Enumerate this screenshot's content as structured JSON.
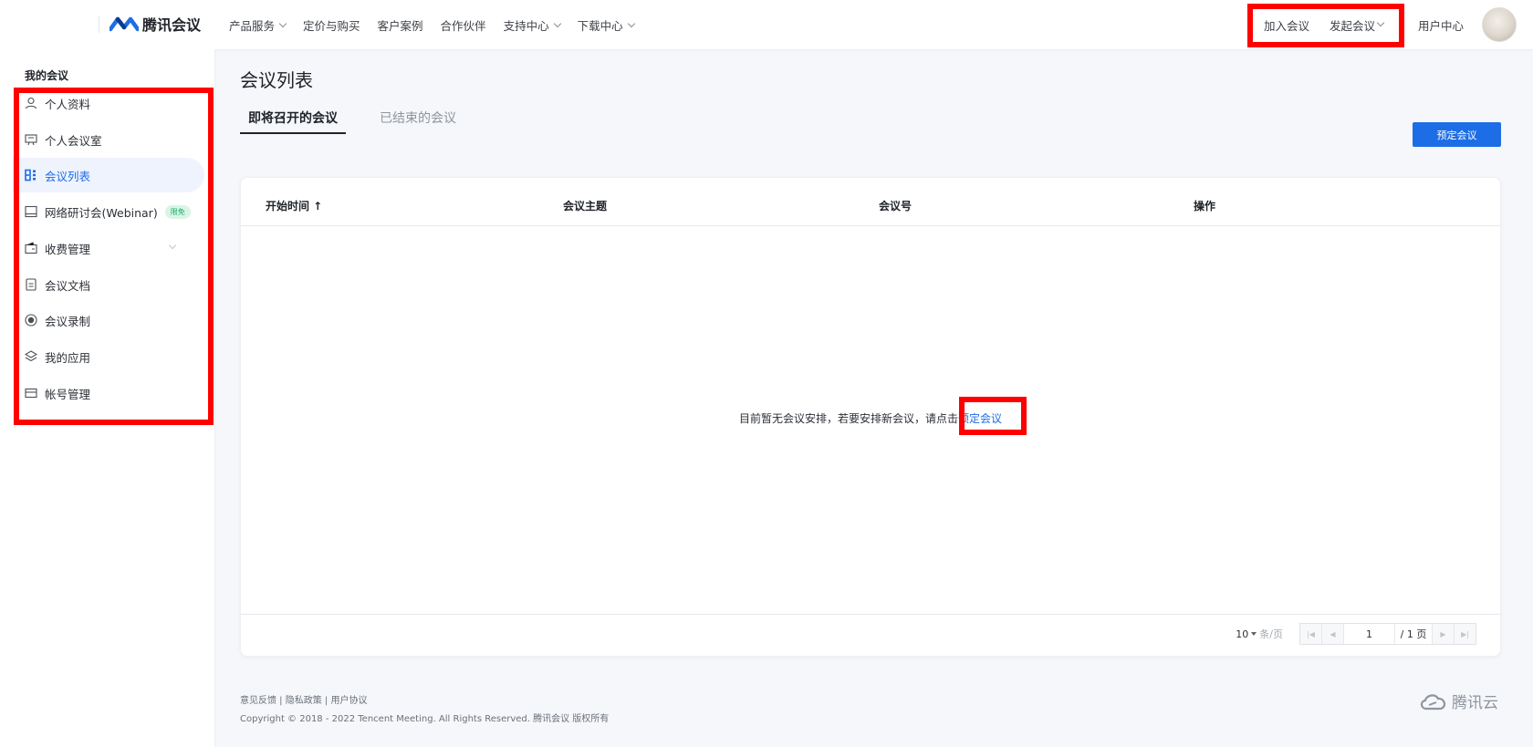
{
  "header": {
    "brand": "腾讯会议",
    "menu": [
      {
        "label": "产品服务",
        "has_dropdown": true
      },
      {
        "label": "定价与购买",
        "has_dropdown": false
      },
      {
        "label": "客户案例",
        "has_dropdown": false
      },
      {
        "label": "合作伙伴",
        "has_dropdown": false
      },
      {
        "label": "支持中心",
        "has_dropdown": true
      },
      {
        "label": "下载中心",
        "has_dropdown": true
      }
    ],
    "join_meeting": "加入会议",
    "start_meeting": "发起会议",
    "user_center": "用户中心"
  },
  "sidebar": {
    "section_title": "我的会议",
    "items": [
      {
        "label": "个人资料",
        "icon": "user-icon"
      },
      {
        "label": "个人会议室",
        "icon": "meeting-room-icon"
      },
      {
        "label": "会议列表",
        "icon": "list-icon",
        "active": true
      },
      {
        "label": "网络研讨会(Webinar)",
        "icon": "webinar-icon",
        "badge": "限免"
      },
      {
        "label": "收费管理",
        "icon": "wallet-icon",
        "has_dropdown": true
      },
      {
        "label": "会议文档",
        "icon": "document-icon"
      },
      {
        "label": "会议录制",
        "icon": "record-icon"
      },
      {
        "label": "我的应用",
        "icon": "apps-icon"
      },
      {
        "label": "帐号管理",
        "icon": "card-icon"
      }
    ]
  },
  "main": {
    "title": "会议列表",
    "tabs": [
      {
        "label": "即将召开的会议",
        "active": true
      },
      {
        "label": "已结束的会议",
        "active": false
      }
    ],
    "schedule_button": "预定会议",
    "table": {
      "columns": [
        "开始时间 ↑",
        "会议主题",
        "会议号",
        "操作"
      ],
      "empty_text": "目前暂无会议安排，若要安排新会议，请点击",
      "empty_link": "预定会议"
    },
    "pagination": {
      "page_size": "10",
      "per_page_label": "条/页",
      "current_page": "1",
      "total_pages": "/ 1 页"
    }
  },
  "footer": {
    "links": [
      "意见反馈",
      "隐私政策",
      "用户协议"
    ],
    "separator": " | ",
    "copyright": "Copyright © 2018 - 2022 Tencent Meeting. All Rights Reserved. 腾讯会议 版权所有",
    "cloud_brand": "腾讯云"
  },
  "colors": {
    "accent": "#1d6de6",
    "annotation_red": "#ff0000"
  }
}
